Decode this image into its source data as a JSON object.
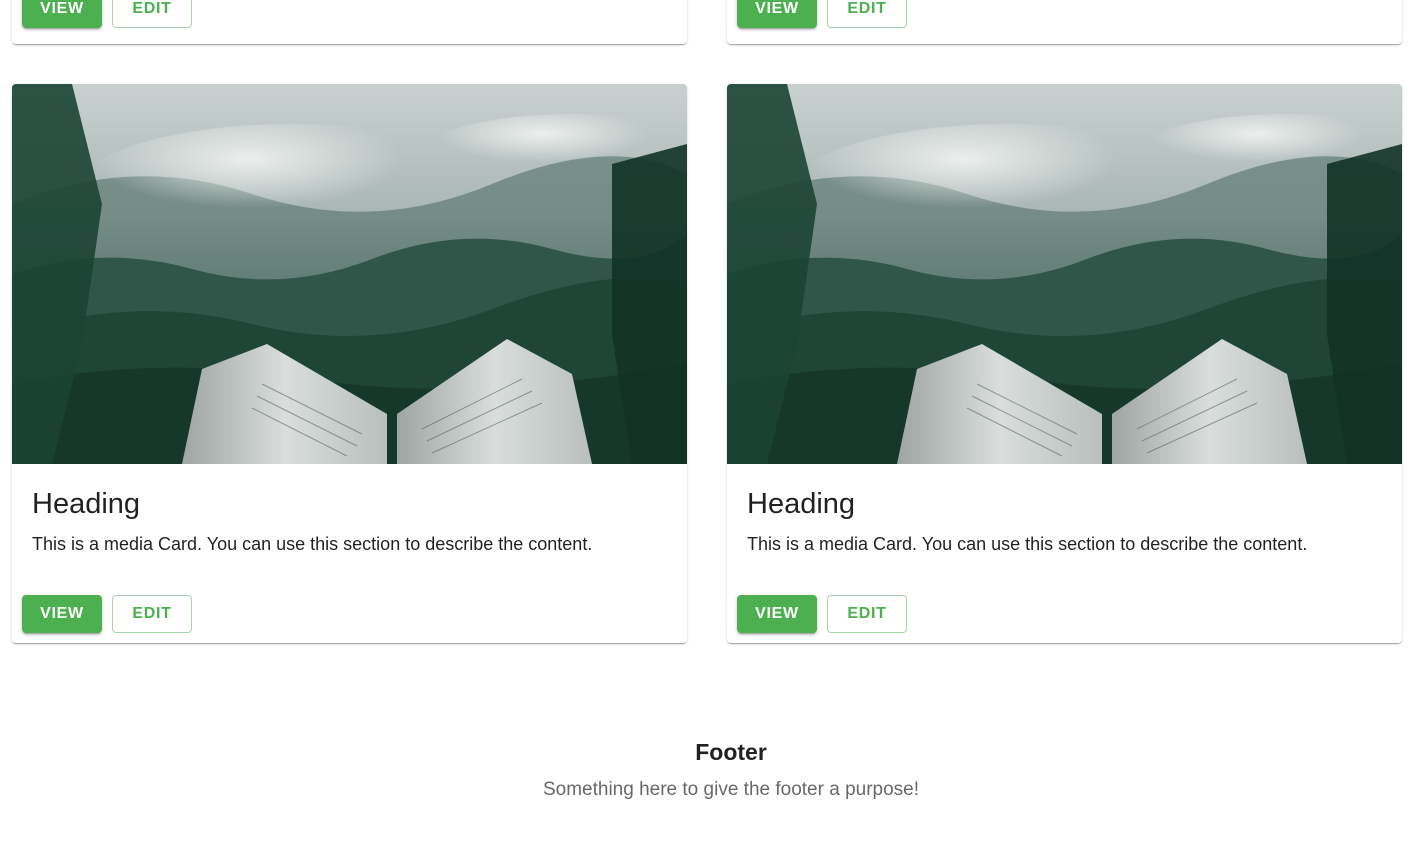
{
  "cards_top": [
    {
      "view_label": "VIEW",
      "edit_label": "EDIT"
    },
    {
      "view_label": "VIEW",
      "edit_label": "EDIT"
    }
  ],
  "cards": [
    {
      "heading": "Heading",
      "text": "This is a media Card. You can use this section to describe the content.",
      "view_label": "VIEW",
      "edit_label": "EDIT"
    },
    {
      "heading": "Heading",
      "text": "This is a media Card. You can use this section to describe the content.",
      "view_label": "VIEW",
      "edit_label": "EDIT"
    }
  ],
  "footer": {
    "title": "Footer",
    "subtitle": "Something here to give the footer a purpose!"
  },
  "colors": {
    "primary": "#4caf50",
    "text": "#212121",
    "muted": "#666666"
  },
  "icons": {
    "media": "misty-forest-open-book-image"
  }
}
